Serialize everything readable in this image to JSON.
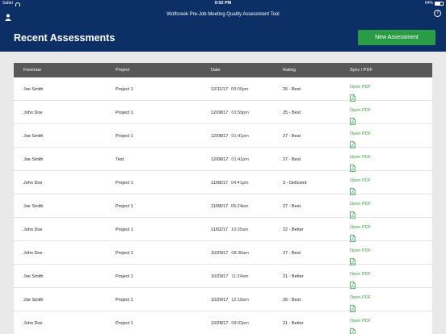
{
  "status_bar": {
    "carrier": "Safari",
    "time": "9:52 PM",
    "battery": "64%",
    "battery_level": 0.64
  },
  "header": {
    "app_title": "Wolfcreek Pre-Job Meeting Quality Assessment Tool",
    "help_label": "?",
    "page_title": "Recent Assessments",
    "new_button_label": "New Assessment"
  },
  "table": {
    "columns": [
      "Foreman",
      "Project",
      "Date",
      "Rating",
      "Sync / PDF"
    ],
    "rows": [
      {
        "foreman": "Joe Smith",
        "project": "Project 1",
        "date": "12/11/17",
        "time": "09:06pm",
        "rating": "26 - Best",
        "pdf": "Open PDF"
      },
      {
        "foreman": "John Doe",
        "project": "Project 1",
        "date": "12/08/17",
        "time": "01:59pm",
        "rating": "25 - Best",
        "pdf": "Open PDF"
      },
      {
        "foreman": "Joe Smith",
        "project": "Project 1",
        "date": "12/08/17",
        "time": "01:41pm",
        "rating": "27 - Best",
        "pdf": "Open PDF"
      },
      {
        "foreman": "Joe Smith",
        "project": "Test",
        "date": "12/08/17",
        "time": "01:41pm",
        "rating": "27 - Best",
        "pdf": "Open PDF"
      },
      {
        "foreman": "John Doe",
        "project": "Project 1",
        "date": "11/08/17",
        "time": "04:41pm",
        "rating": "3 - Deficient",
        "pdf": "Open PDF"
      },
      {
        "foreman": "Joe Smith",
        "project": "Project 1",
        "date": "11/08/17",
        "time": "05:24pm",
        "rating": "27 - Best",
        "pdf": "Open PDF"
      },
      {
        "foreman": "John Doe",
        "project": "Project 1",
        "date": "11/02/17",
        "time": "10:35am",
        "rating": "22 - Better",
        "pdf": "Open PDF"
      },
      {
        "foreman": "John Doe",
        "project": "Project 1",
        "date": "10/29/17",
        "time": "08:38am",
        "rating": "27 - Best",
        "pdf": "Open PDF"
      },
      {
        "foreman": "Joe Smith",
        "project": "Project 1",
        "date": "10/29/17",
        "time": "11:24am",
        "rating": "21 - Better",
        "pdf": "Open PDF"
      },
      {
        "foreman": "Joe Smith",
        "project": "Project 1",
        "date": "10/29/17",
        "time": "12:18am",
        "rating": "26 - Best",
        "pdf": "Open PDF"
      },
      {
        "foreman": "John Doe",
        "project": "Project 1",
        "date": "10/28/17",
        "time": "08:02pm",
        "rating": "21 - Better",
        "pdf": "Open PDF"
      }
    ]
  },
  "colors": {
    "header_bg": "#0c2f66",
    "accent_green": "#2b9b45",
    "table_header_bg": "#585858"
  },
  "icons": {
    "user": "user-icon",
    "help": "help-icon",
    "pdf": "pdf-file-icon"
  }
}
